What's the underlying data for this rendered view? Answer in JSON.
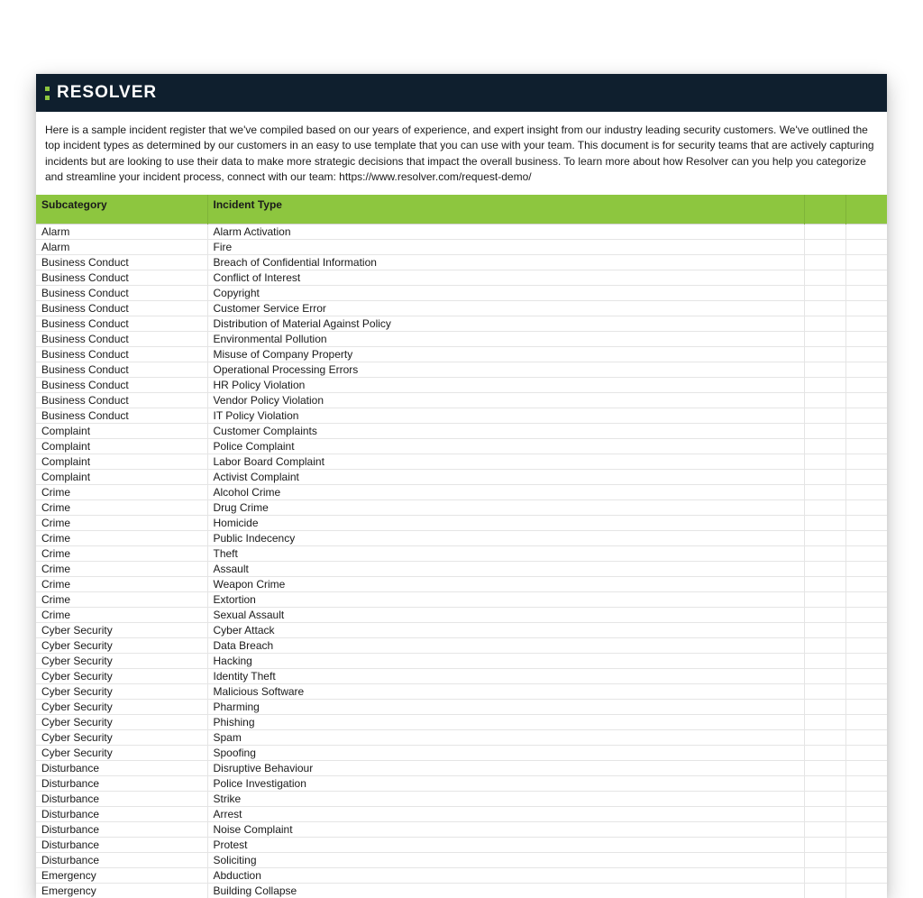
{
  "brand": {
    "name": "RESOLVER"
  },
  "intro": {
    "text": "Here is a sample incident register that we've compiled based on our years of experience, and expert insight from our industry leading security customers. We've outlined the top incident types as determined by our customers in an easy to use template that you can use with your team. This document is for security teams that are actively capturing incidents but are looking to use their data to make more strategic decisions that impact the overall business. To learn more about how Resolver can you help you categorize and streamline your incident process, connect with our team: https://www.resolver.com/request-demo/"
  },
  "table": {
    "headers": {
      "subcategory": "Subcategory",
      "incident_type": "Incident Type",
      "col3": "",
      "col4": ""
    },
    "rows": [
      {
        "subcategory": "Alarm",
        "incident_type": "Alarm Activation"
      },
      {
        "subcategory": "Alarm",
        "incident_type": "Fire"
      },
      {
        "subcategory": "Business Conduct",
        "incident_type": "Breach of Confidential Information"
      },
      {
        "subcategory": "Business Conduct",
        "incident_type": "Conflict of Interest"
      },
      {
        "subcategory": "Business Conduct",
        "incident_type": "Copyright"
      },
      {
        "subcategory": "Business Conduct",
        "incident_type": "Customer Service Error"
      },
      {
        "subcategory": "Business Conduct",
        "incident_type": "Distribution of Material Against Policy"
      },
      {
        "subcategory": "Business Conduct",
        "incident_type": "Environmental Pollution"
      },
      {
        "subcategory": "Business Conduct",
        "incident_type": "Misuse of Company Property"
      },
      {
        "subcategory": "Business Conduct",
        "incident_type": "Operational Processing Errors"
      },
      {
        "subcategory": "Business Conduct",
        "incident_type": "HR Policy Violation"
      },
      {
        "subcategory": "Business Conduct",
        "incident_type": "Vendor Policy Violation"
      },
      {
        "subcategory": "Business Conduct",
        "incident_type": "IT Policy Violation"
      },
      {
        "subcategory": "Complaint",
        "incident_type": "Customer Complaints"
      },
      {
        "subcategory": "Complaint",
        "incident_type": "Police Complaint"
      },
      {
        "subcategory": "Complaint",
        "incident_type": "Labor Board Complaint"
      },
      {
        "subcategory": "Complaint",
        "incident_type": "Activist Complaint"
      },
      {
        "subcategory": "Crime",
        "incident_type": "Alcohol Crime"
      },
      {
        "subcategory": "Crime",
        "incident_type": "Drug Crime"
      },
      {
        "subcategory": "Crime",
        "incident_type": "Homicide"
      },
      {
        "subcategory": "Crime",
        "incident_type": "Public Indecency"
      },
      {
        "subcategory": "Crime",
        "incident_type": "Theft"
      },
      {
        "subcategory": "Crime",
        "incident_type": "Assault"
      },
      {
        "subcategory": "Crime",
        "incident_type": "Weapon Crime"
      },
      {
        "subcategory": "Crime",
        "incident_type": "Extortion"
      },
      {
        "subcategory": "Crime",
        "incident_type": "Sexual Assault"
      },
      {
        "subcategory": "Cyber Security",
        "incident_type": "Cyber Attack"
      },
      {
        "subcategory": "Cyber Security",
        "incident_type": "Data Breach"
      },
      {
        "subcategory": "Cyber Security",
        "incident_type": "Hacking"
      },
      {
        "subcategory": "Cyber Security",
        "incident_type": "Identity Theft"
      },
      {
        "subcategory": "Cyber Security",
        "incident_type": "Malicious Software"
      },
      {
        "subcategory": "Cyber Security",
        "incident_type": "Pharming"
      },
      {
        "subcategory": "Cyber Security",
        "incident_type": "Phishing"
      },
      {
        "subcategory": "Cyber Security",
        "incident_type": "Spam"
      },
      {
        "subcategory": "Cyber Security",
        "incident_type": "Spoofing"
      },
      {
        "subcategory": "Disturbance",
        "incident_type": "Disruptive Behaviour"
      },
      {
        "subcategory": "Disturbance",
        "incident_type": "Police Investigation"
      },
      {
        "subcategory": "Disturbance",
        "incident_type": "Strike"
      },
      {
        "subcategory": "Disturbance",
        "incident_type": "Arrest"
      },
      {
        "subcategory": "Disturbance",
        "incident_type": "Noise Complaint"
      },
      {
        "subcategory": "Disturbance",
        "incident_type": "Protest"
      },
      {
        "subcategory": "Disturbance",
        "incident_type": "Soliciting"
      },
      {
        "subcategory": "Emergency",
        "incident_type": "Abduction"
      },
      {
        "subcategory": "Emergency",
        "incident_type": "Building Collapse"
      }
    ]
  }
}
